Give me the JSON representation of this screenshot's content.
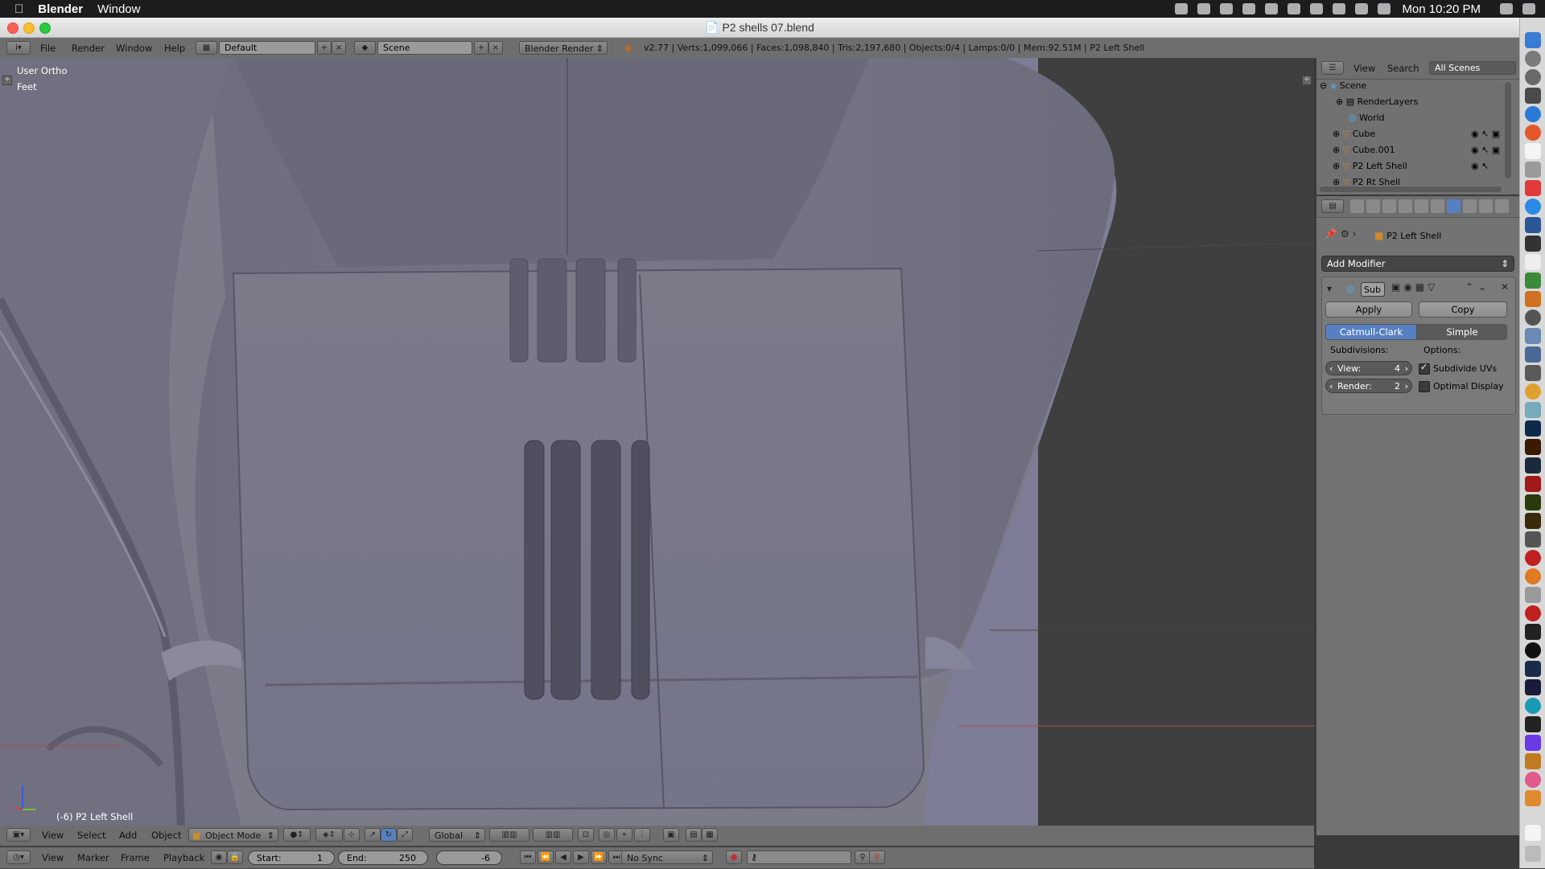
{
  "menubar": {
    "app": "Blender",
    "window": "Window",
    "clock": "Mon 10:20 PM"
  },
  "window": {
    "title": "P2 shells 07.blend"
  },
  "info_header": {
    "menus": [
      "File",
      "Render",
      "Window",
      "Help"
    ],
    "layout": "Default",
    "scene": "Scene",
    "engine": "Blender Render",
    "stats": "v2.77 | Verts:1,099,066 | Faces:1,098,840 | Tris:2,197,680 | Objects:0/4 | Lamps:0/0 | Mem:92.51M | P2 Left Shell"
  },
  "viewport": {
    "view_name": "User Ortho",
    "units": "Feet",
    "object_label": "(-6) P2 Left Shell"
  },
  "viewport_header": {
    "menus": [
      "View",
      "Select",
      "Add",
      "Object"
    ],
    "mode": "Object Mode",
    "orientation": "Global"
  },
  "timeline": {
    "menus": [
      "View",
      "Marker",
      "Frame",
      "Playback"
    ],
    "start_label": "Start:",
    "start": "1",
    "end_label": "End:",
    "end": "250",
    "current": "-6",
    "sync": "No Sync"
  },
  "outliner": {
    "menus": [
      "View",
      "Search"
    ],
    "filter": "All Scenes",
    "items": [
      "Scene",
      "RenderLayers",
      "World",
      "Cube",
      "Cube.001",
      "P2 Left Shell",
      "P2 Rt Shell"
    ]
  },
  "properties": {
    "object": "P2 Left Shell",
    "add_modifier": "Add Modifier",
    "modifier_name": "Sub",
    "apply": "Apply",
    "copy": "Copy",
    "tab_catmull": "Catmull-Clark",
    "tab_simple": "Simple",
    "subdivisions_label": "Subdivisions:",
    "options_label": "Options:",
    "view_label": "View:",
    "view_value": "4",
    "render_label": "Render:",
    "render_value": "2",
    "subdivide_uvs": "Subdivide UVs",
    "optimal_display": "Optimal Display"
  },
  "colors": {
    "accent": "#5680c2",
    "viewport_bg": "#7b7b8a",
    "panel_bg": "#737373"
  }
}
